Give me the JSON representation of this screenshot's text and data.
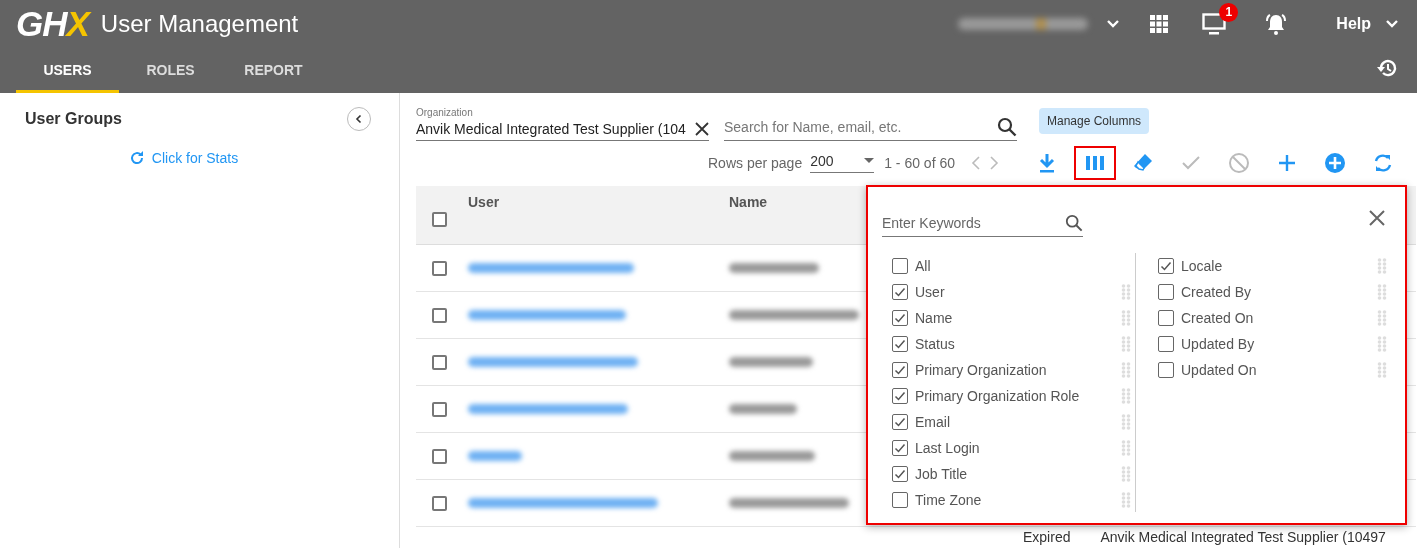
{
  "header": {
    "logo": "GHX",
    "title": "User Management",
    "notification_count": "1",
    "help": "Help"
  },
  "tabs": [
    {
      "label": "USERS",
      "selected": true
    },
    {
      "label": "ROLES",
      "selected": false
    },
    {
      "label": "REPORT",
      "selected": false
    }
  ],
  "sidebar": {
    "title": "User Groups",
    "stats_link": "Click for Stats"
  },
  "organization_field": {
    "label": "Organization",
    "value": "Anvik Medical Integrated Test Supplier (104"
  },
  "search": {
    "placeholder": "Search for Name, email, etc."
  },
  "tooltip": "Manage Columns",
  "pagination": {
    "rows_label": "Rows per page",
    "rows_per_page": "200",
    "range": "1 - 60 of 60"
  },
  "toolbar": [
    {
      "kind": "download",
      "disabled": false,
      "highlighted": false
    },
    {
      "kind": "columns",
      "disabled": false,
      "highlighted": true
    },
    {
      "kind": "eraser",
      "disabled": false,
      "highlighted": false
    },
    {
      "kind": "check",
      "disabled": true,
      "highlighted": false
    },
    {
      "kind": "block",
      "disabled": true,
      "highlighted": false
    },
    {
      "kind": "add",
      "disabled": false,
      "highlighted": false
    },
    {
      "kind": "add-circle",
      "disabled": false,
      "highlighted": false
    },
    {
      "kind": "sync",
      "disabled": false,
      "highlighted": false
    }
  ],
  "table": {
    "select_all": false,
    "columns": [
      "User",
      "Name"
    ],
    "rows": [
      {
        "checked": false
      },
      {
        "checked": false
      },
      {
        "checked": false
      },
      {
        "checked": false
      },
      {
        "checked": false
      },
      {
        "checked": false
      }
    ],
    "partial_row": {
      "status": "Expired",
      "primary_organization": "Anvik Medical Integrated Test Supplier (10497"
    }
  },
  "column_picker": {
    "search_placeholder": "Enter Keywords",
    "columns": [
      [
        {
          "kind": "all",
          "label": "All",
          "checked": false
        },
        {
          "kind": "column",
          "label": "User",
          "checked": true
        },
        {
          "kind": "column",
          "label": "Name",
          "checked": true
        },
        {
          "kind": "column",
          "label": "Status",
          "checked": true
        },
        {
          "kind": "column",
          "label": "Primary Organization",
          "checked": true
        },
        {
          "kind": "column",
          "label": "Primary Organization Role",
          "checked": true
        },
        {
          "kind": "column",
          "label": "Email",
          "checked": true
        },
        {
          "kind": "column",
          "label": "Last Login",
          "checked": true
        },
        {
          "kind": "column",
          "label": "Job Title",
          "checked": true
        },
        {
          "kind": "column",
          "label": "Time Zone",
          "checked": false
        }
      ],
      [
        {
          "kind": "column",
          "label": "Locale",
          "checked": true
        },
        {
          "kind": "column",
          "label": "Created By",
          "checked": false
        },
        {
          "kind": "column",
          "label": "Created On",
          "checked": false
        },
        {
          "kind": "column",
          "label": "Updated By",
          "checked": false
        },
        {
          "kind": "column",
          "label": "Updated On",
          "checked": false
        }
      ]
    ]
  }
}
